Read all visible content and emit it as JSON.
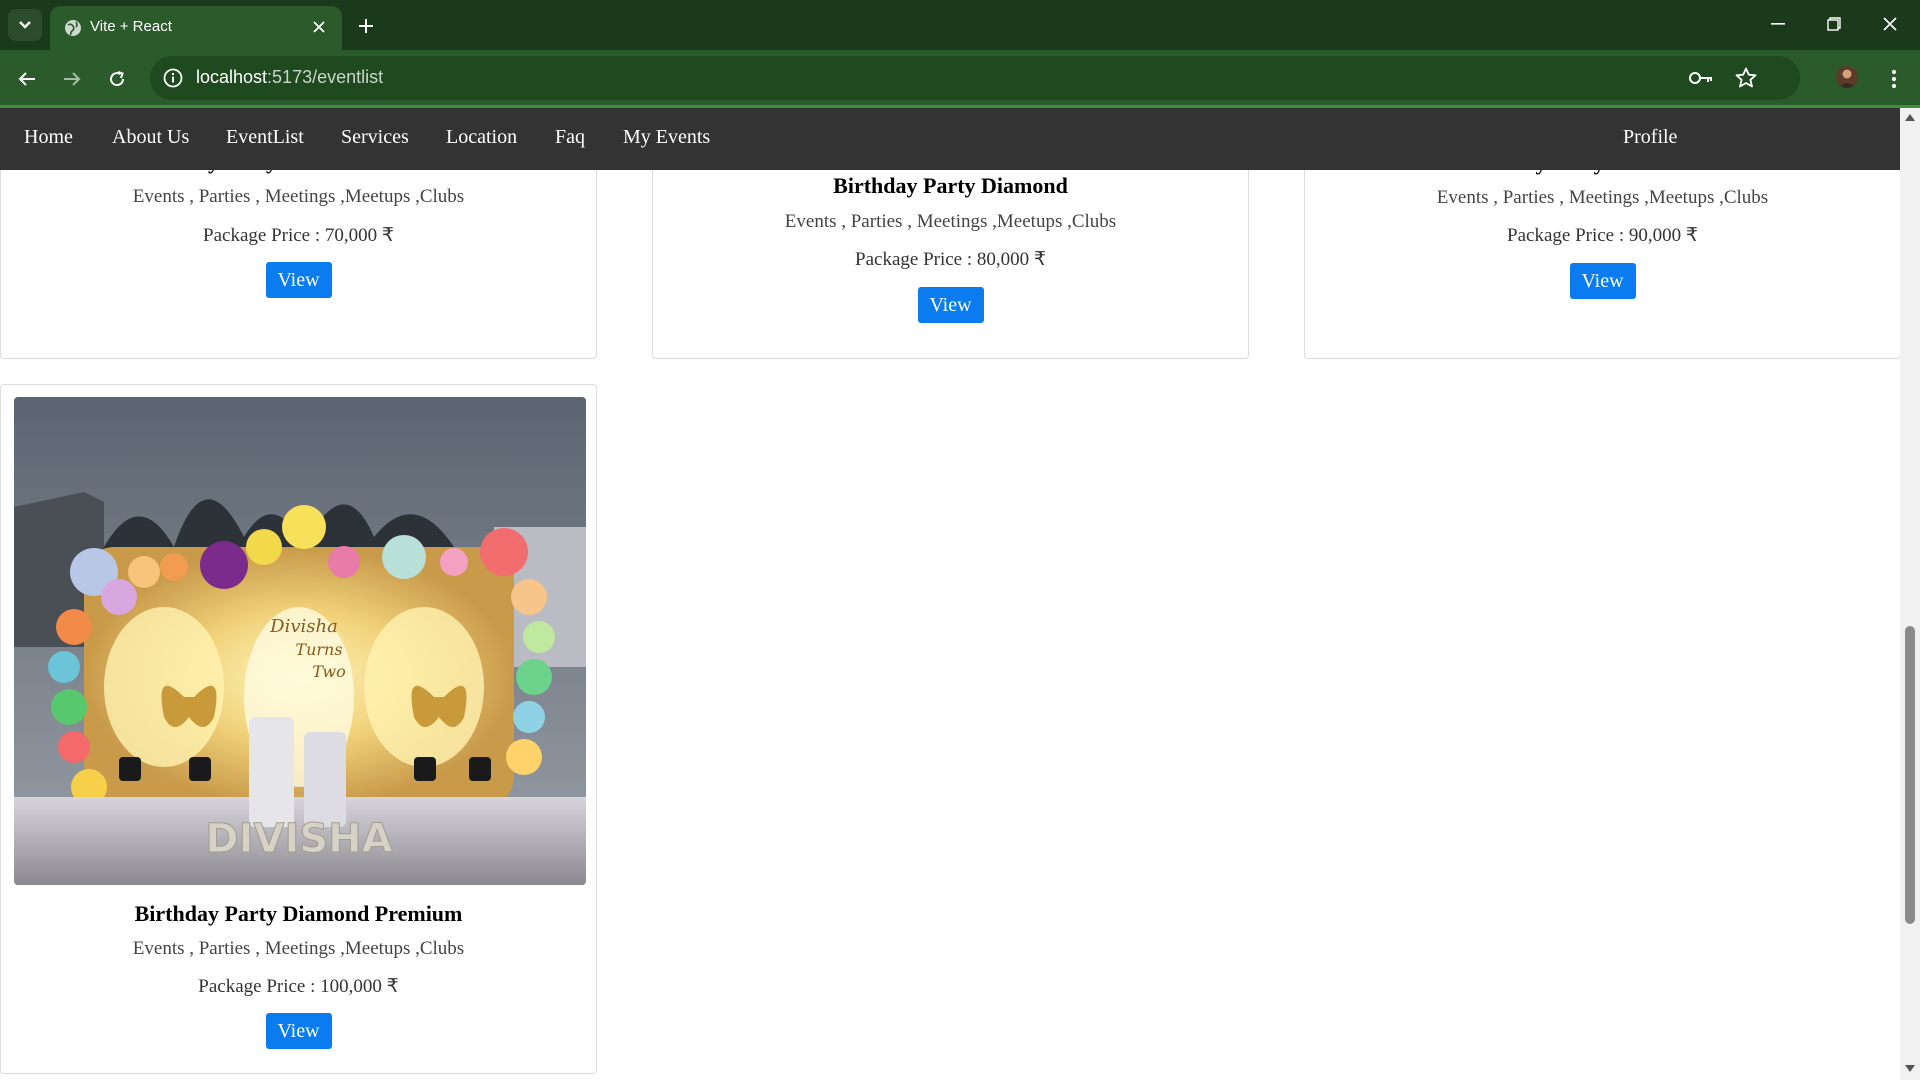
{
  "browser": {
    "tab_title": "Vite + React",
    "url_host": "localhost",
    "url_path": ":5173/eventlist",
    "icons": [
      "tab-dropdown-icon",
      "globe-icon",
      "close-icon",
      "plus-icon",
      "minimize-icon",
      "restore-icon",
      "window-close-icon",
      "back-icon",
      "forward-icon",
      "reload-icon",
      "info-icon",
      "key-icon",
      "star-icon",
      "avatar",
      "kebab-menu-icon"
    ]
  },
  "site_nav": {
    "home": "Home",
    "about": "About Us",
    "eventlist": "EventList",
    "services": "Services",
    "location": "Location",
    "faq": "Faq",
    "my_events": "My Events",
    "profile": "Profile"
  },
  "cards": [
    {
      "title": "Birthday Party Platinum Premium",
      "tags": "Events , Parties , Meetings ,Meetups ,Clubs",
      "price": "Package Price : 70,000 ₹",
      "button": "View"
    },
    {
      "title": "Birthday Party Diamond",
      "tags": "Events , Parties , Meetings ,Meetups ,Clubs",
      "price": "Package Price : 80,000 ₹",
      "button": "View"
    },
    {
      "title": "Birthday Party Diamond Plus",
      "tags": "Events , Parties , Meetings ,Meetups ,Clubs",
      "price": "Package Price : 90,000 ₹",
      "button": "View"
    },
    {
      "title": "Birthday Party Diamond Premium",
      "tags": "Events , Parties , Meetings ,Meetups ,Clubs",
      "price": "Package Price : 100,000 ₹",
      "button": "View",
      "image_text": "Divisha Turns Two",
      "image_letters": "DIVISHA"
    }
  ],
  "colors": {
    "tabbar": "#1b3a1b",
    "toolbar": "#2b5a2b",
    "site_nav": "#333333",
    "button": "#0a7cf0"
  }
}
